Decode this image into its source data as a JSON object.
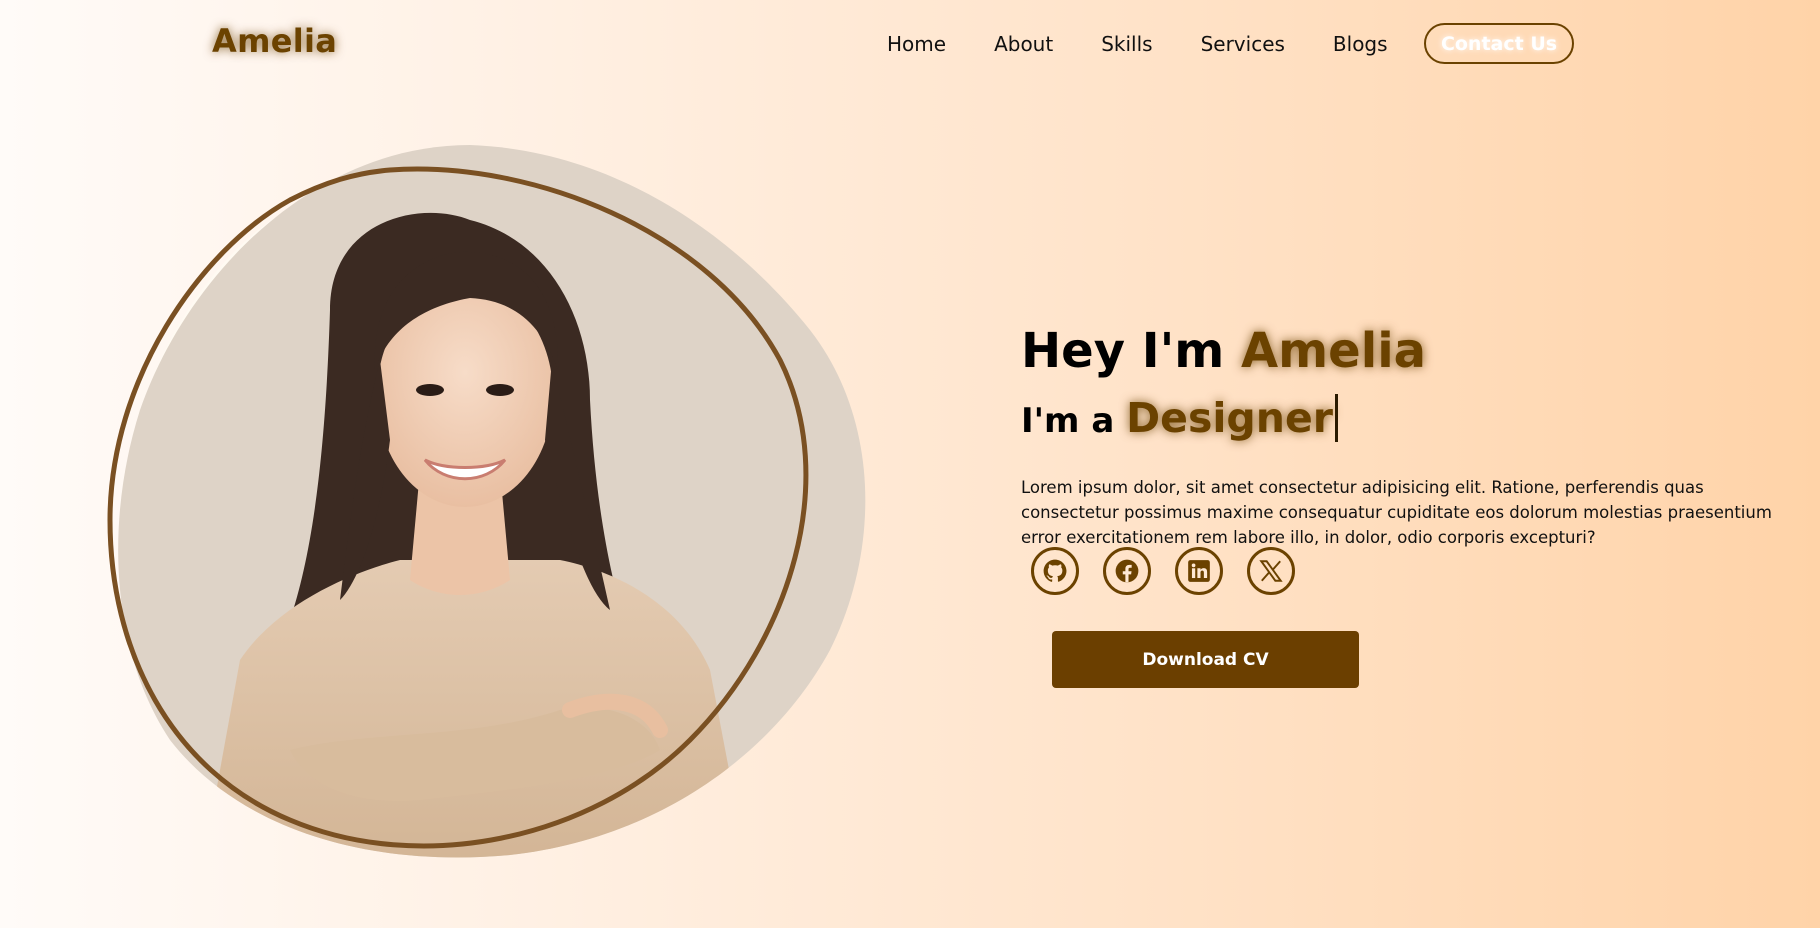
{
  "header": {
    "logo": "Amelia",
    "nav": [
      {
        "label": "Home"
      },
      {
        "label": "About"
      },
      {
        "label": "Skills"
      },
      {
        "label": "Services"
      },
      {
        "label": "Blogs"
      }
    ],
    "contact_label": "Contact Us"
  },
  "hero": {
    "greeting": "Hey I'm ",
    "name": "Amelia",
    "role_prefix": "I'm a ",
    "role": "Designer",
    "description": "Lorem ipsum dolor, sit amet consectetur adipisicing elit. Ratione, perferendis quas consectetur possimus maxime consequatur cupiditate eos dolorum molestias praesentium error exercitationem rem labore illo, in dolor, odio corporis excepturi?",
    "download_label": "Download CV"
  },
  "socials": [
    {
      "icon": "github-icon"
    },
    {
      "icon": "facebook-icon"
    },
    {
      "icon": "linkedin-icon"
    },
    {
      "icon": "x-icon"
    }
  ],
  "colors": {
    "accent": "#6b4200",
    "button": "#6b3f00",
    "background_start": "#fffbf8",
    "background_end": "#ffd3a8"
  }
}
